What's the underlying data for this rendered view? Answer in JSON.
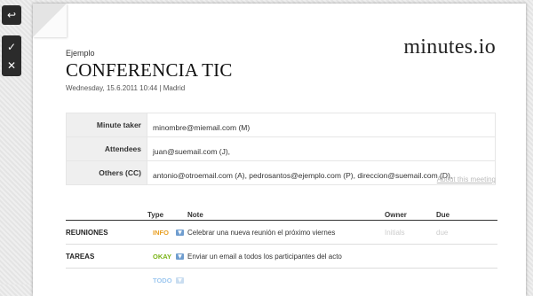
{
  "toolbar": {
    "back_icon": "↩",
    "check_icon": "✓",
    "close_icon": "✕"
  },
  "brand": "minutes.io",
  "meeting": {
    "kicker": "Ejemplo",
    "title": "CONFERENCIA TIC",
    "meta": "Wednesday, 15.6.2011 10:44 | Madrid"
  },
  "attendees": [
    {
      "label": "Minute taker",
      "value": "minombre@miemail.com (M)"
    },
    {
      "label": "Attendees",
      "value": "juan@suemail.com (J),"
    },
    {
      "label": "Others (CC)",
      "value": "antonio@otroemail.com (A), pedrosantos@ejemplo.com (P), direccion@suemail.com (D),"
    }
  ],
  "about_link": "About this meeting",
  "columns": {
    "type": "Type",
    "note": "Note",
    "owner": "Owner",
    "due": "Due"
  },
  "items": [
    {
      "section": "REUNIONES",
      "type": "INFO",
      "note": "Celebrar una nueva reunión el próximo viernes",
      "owner": "Initials",
      "due": "due"
    },
    {
      "section": "TAREAS",
      "type": "OKAY",
      "note": "Enviar un email a todos los participantes del acto",
      "owner": "",
      "due": ""
    },
    {
      "section": "",
      "type": "TODO",
      "note": "",
      "owner": "",
      "due": ""
    }
  ],
  "colors": {
    "info": "#e8a024",
    "okay": "#7ab317",
    "todo": "#9ec8f0"
  }
}
